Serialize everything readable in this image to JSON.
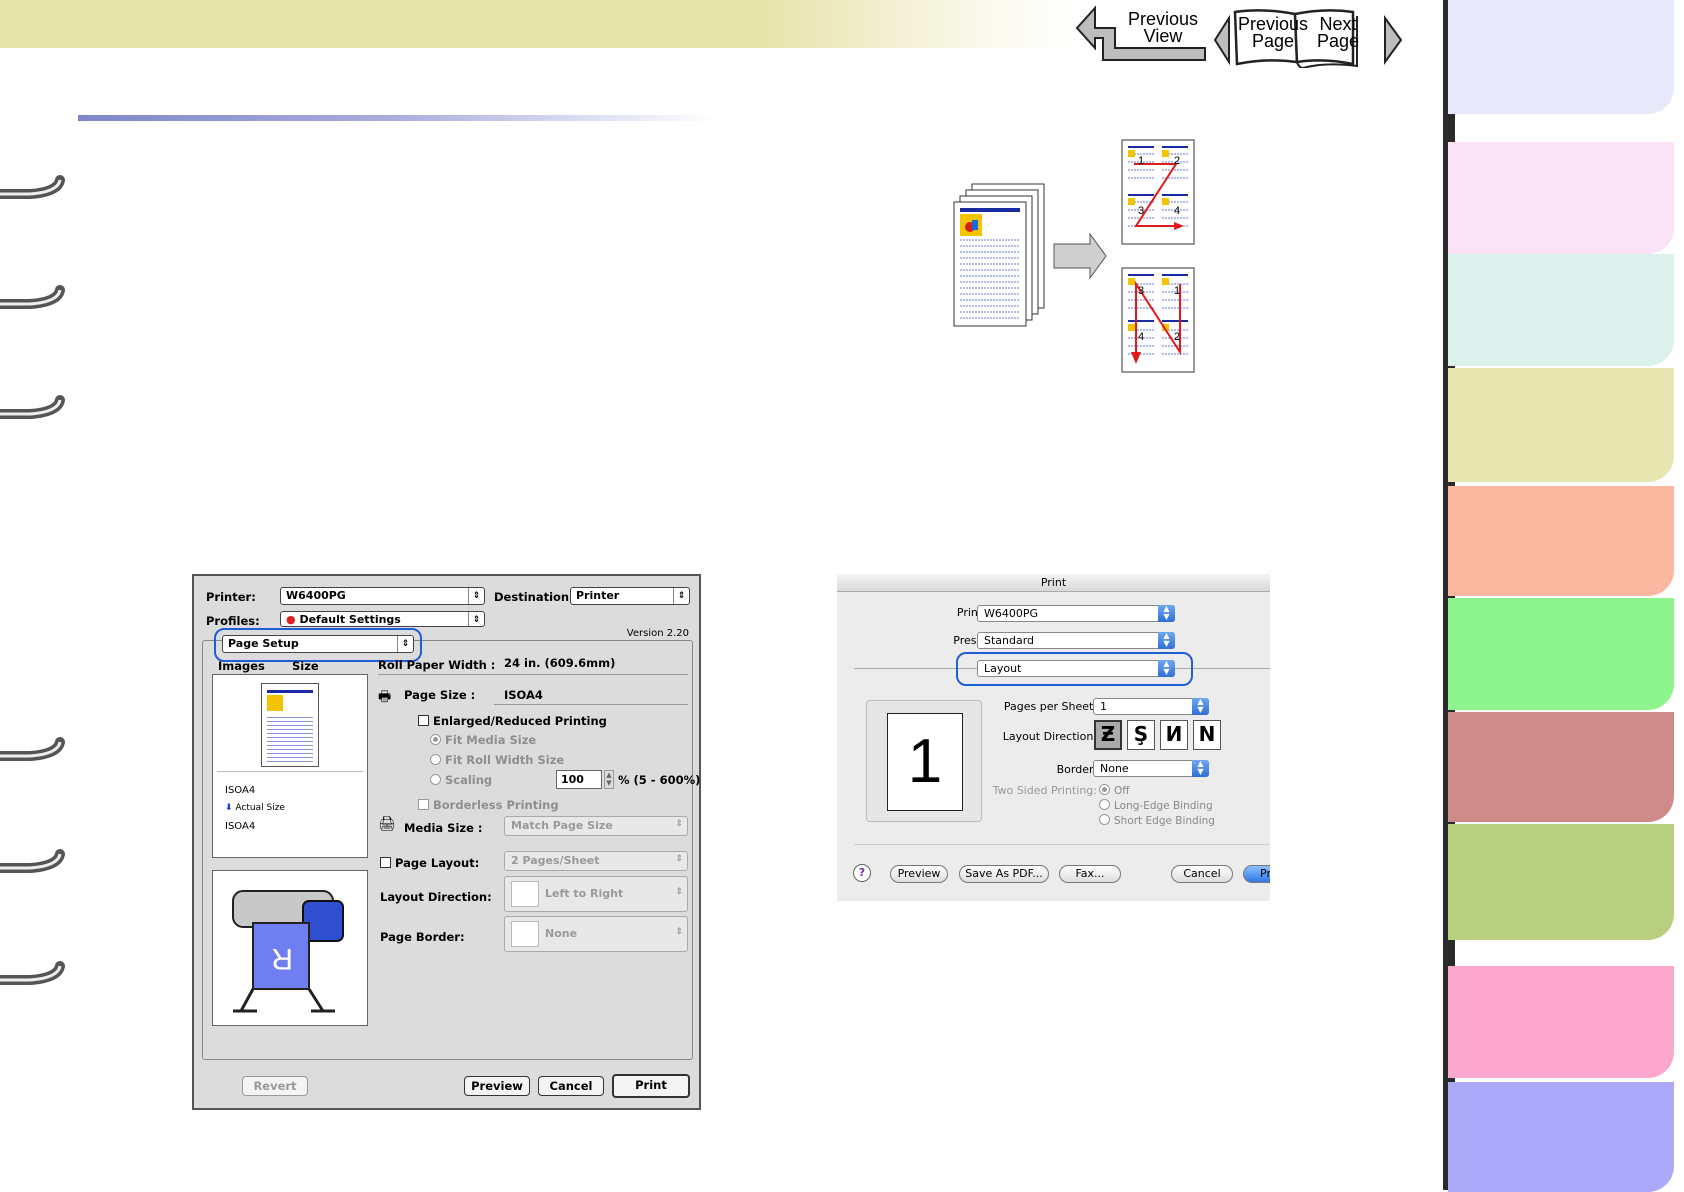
{
  "navigation": {
    "previous_view_line1": "Previous",
    "previous_view_line2": "View",
    "previous_page_line1": "Previous",
    "previous_page_line2": "Page",
    "next_page_line1": "Next",
    "next_page_line2": "Page"
  },
  "side_tabs": [
    {
      "color": "#e8e8fb"
    },
    {
      "color": "#fbe3f7"
    },
    {
      "color": "#dcf1ec"
    },
    {
      "color": "#e8e6b0"
    },
    {
      "color": "#fbb7a0"
    },
    {
      "color": "#8ef58e"
    },
    {
      "color": "#cf8a8a"
    },
    {
      "color": "#b8cf80"
    },
    {
      "color": "#fba8cc"
    },
    {
      "color": "#acaaf8"
    }
  ],
  "diagram": {
    "page_numbers_z": [
      "1",
      "2",
      "3",
      "4"
    ],
    "page_numbers_n": [
      "3",
      "1",
      "4",
      "2"
    ]
  },
  "windows_dialog": {
    "printer_label": "Printer:",
    "printer_value": "W6400PG",
    "destination_label": "Destination:",
    "destination_value": "Printer",
    "profiles_label": "Profiles:",
    "profiles_value": "Default Settings",
    "version": "Version 2.20",
    "panel_select": "Page Setup",
    "tabs": [
      "Images",
      "Size"
    ],
    "preview_paper": "ISOA4",
    "preview_size": "Actual Size",
    "preview_output": "ISOA4",
    "roll_paper_width_label": "Roll Paper Width :",
    "roll_paper_width_value": "24 in. (609.6mm)",
    "page_size_label": "Page Size :",
    "page_size_value": "ISOA4",
    "enlarged_reduced": "Enlarged/Reduced Printing",
    "fit_media_size": "Fit Media Size",
    "fit_roll_width": "Fit Roll Width Size",
    "scaling": "Scaling",
    "scaling_value": "100",
    "scaling_range": "% (5 - 600%)",
    "borderless": "Borderless Printing",
    "media_size_label": "Media Size :",
    "media_size_value": "Match Page Size",
    "page_layout_label": "Page Layout:",
    "page_layout_value": "2 Pages/Sheet",
    "layout_direction_label": "Layout Direction:",
    "layout_direction_value": "Left to Right",
    "page_border_label": "Page Border:",
    "page_border_value": "None",
    "revert": "Revert",
    "preview": "Preview",
    "cancel": "Cancel",
    "print": "Print"
  },
  "mac_dialog": {
    "title": "Print",
    "printer_label": "Printer:",
    "printer_value": "W6400PG",
    "presets_label": "Presets:",
    "presets_value": "Standard",
    "panel_value": "Layout",
    "preview_number": "1",
    "pages_per_sheet_label": "Pages per Sheet:",
    "pages_per_sheet_value": "1",
    "layout_direction_label": "Layout Direction:",
    "border_label": "Border:",
    "border_value": "None",
    "two_sided_label": "Two Sided Printing:",
    "two_sided_options": [
      "Off",
      "Long-Edge Binding",
      "Short Edge Binding"
    ],
    "help": "?",
    "preview": "Preview",
    "save_pdf": "Save As PDF...",
    "fax": "Fax...",
    "cancel": "Cancel",
    "print": "Pr"
  }
}
